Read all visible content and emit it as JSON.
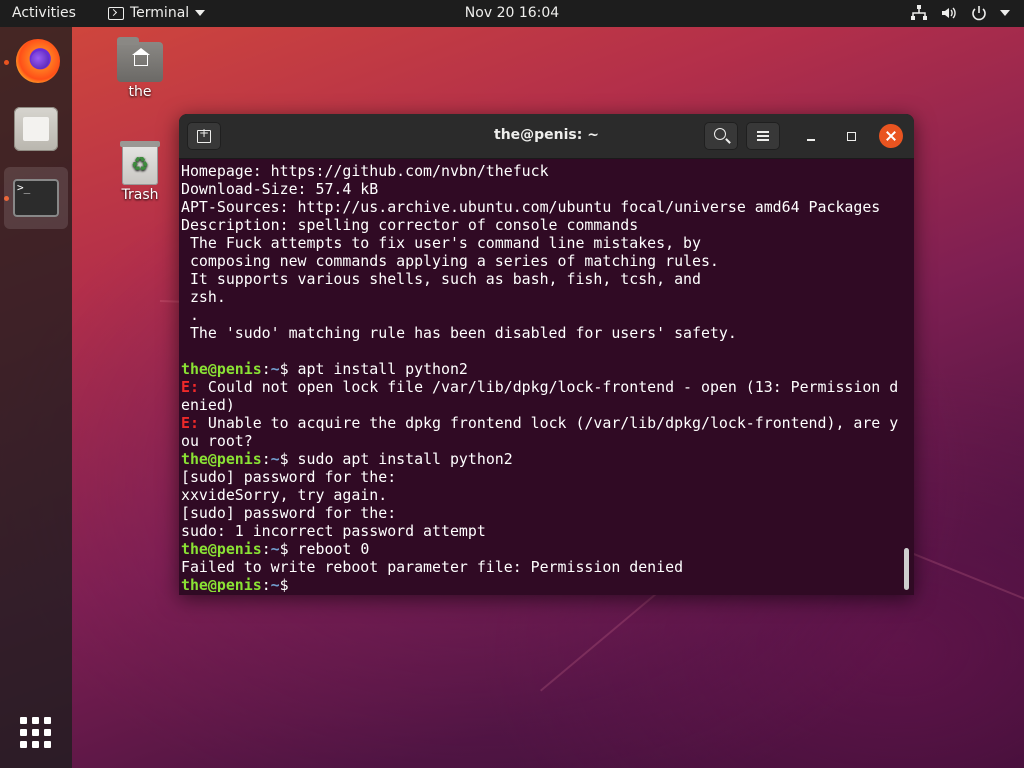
{
  "topbar": {
    "activities": "Activities",
    "app_name": "Terminal",
    "clock": "Nov 20  16:04",
    "tray_icons": [
      "network-icon",
      "volume-icon",
      "power-icon",
      "chevron-down-icon"
    ]
  },
  "dock": {
    "items": [
      "firefox-icon",
      "files-icon",
      "terminal-icon"
    ],
    "apps_grid": "show-applications-icon"
  },
  "desktop": {
    "home_label": "the",
    "trash_label": "Trash"
  },
  "window": {
    "title": "the@penis: ~",
    "accent": "#e95420",
    "background": "#300a24"
  },
  "terminal": {
    "prompt_user": "the@penis",
    "prompt_path": "~",
    "prompt_end": "$",
    "lines": [
      {
        "t": "Homepage: https://github.com/nvbn/thefuck"
      },
      {
        "t": "Download-Size: 57.4 kB"
      },
      {
        "t": "APT-Sources: http://us.archive.ubuntu.com/ubuntu focal/universe amd64 Packages"
      },
      {
        "t": "Description: spelling corrector of console commands"
      },
      {
        "t": " The Fuck attempts to fix user's command line mistakes, by"
      },
      {
        "t": " composing new commands applying a series of matching rules."
      },
      {
        "t": " It supports various shells, such as bash, fish, tcsh, and"
      },
      {
        "t": " zsh."
      },
      {
        "t": " ."
      },
      {
        "t": " The 'sudo' matching rule has been disabled for users' safety."
      },
      {
        "t": ""
      },
      {
        "p": true,
        "t": " apt install python2"
      },
      {
        "e": "E:",
        "t": " Could not open lock file /var/lib/dpkg/lock-frontend - open (13: Permission d"
      },
      {
        "t": "enied)"
      },
      {
        "e": "E:",
        "t": " Unable to acquire the dpkg frontend lock (/var/lib/dpkg/lock-frontend), are y"
      },
      {
        "t": "ou root?"
      },
      {
        "p": true,
        "t": " sudo apt install python2"
      },
      {
        "t": "[sudo] password for the:"
      },
      {
        "t": "xxvideSorry, try again."
      },
      {
        "t": "[sudo] password for the:"
      },
      {
        "t": "sudo: 1 incorrect password attempt"
      },
      {
        "p": true,
        "t": " reboot 0"
      },
      {
        "t": "Failed to write reboot parameter file: Permission denied"
      },
      {
        "p": true,
        "t": " "
      }
    ]
  }
}
